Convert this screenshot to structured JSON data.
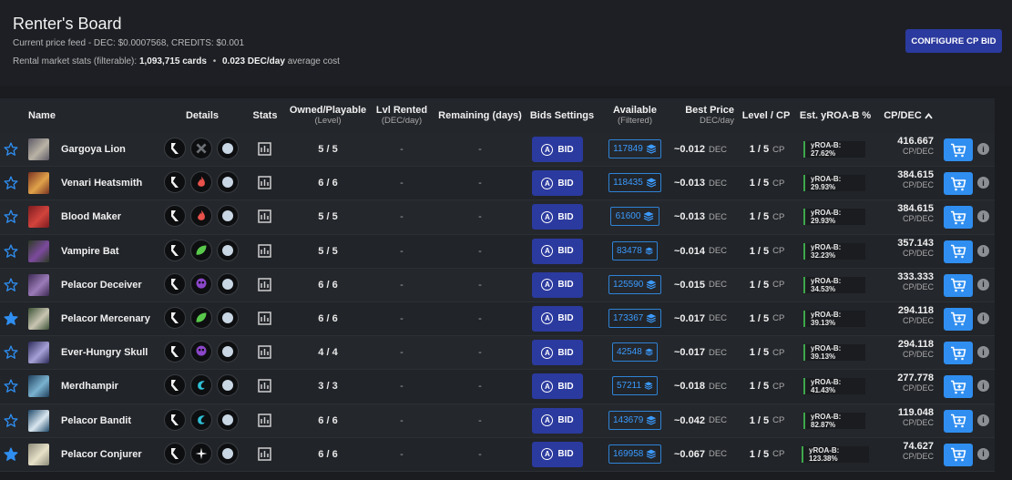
{
  "header": {
    "title": "Renter's Board",
    "price_feed_label": "Current price feed - DEC: $0.0007568, CREDITS: $0.001",
    "stats_prefix": "Rental market stats (filterable):",
    "stats_cards": "1,093,715 cards",
    "stats_sep": "•",
    "stats_cost": "0.023 DEC/day",
    "stats_suffix": "average cost",
    "configure_button": "CONFIGURE CP BID"
  },
  "columns": {
    "name": "Name",
    "details": "Details",
    "stats": "Stats",
    "owned": "Owned/Playable",
    "owned_sub": "(Level)",
    "lvl_rented": "Lvl Rented",
    "lvl_rented_sub": "(DEC/day)",
    "remaining": "Remaining (days)",
    "bids_settings": "Bids Settings",
    "available": "Available",
    "available_sub": "(Filtered)",
    "best_price": "Best Price",
    "best_price_sub": "DEC/day",
    "level_cp": "Level / CP",
    "est_yroa": "Est. yROA-B %",
    "cp_dec": "CP/DEC",
    "sort_icon": "chevron-up-icon"
  },
  "labels": {
    "bid": "BID",
    "dec": "DEC",
    "cp": "CP",
    "cp_dec_unit": "CP/DEC",
    "dash": "-"
  },
  "colors": {
    "accent_blue": "#2b3a9e",
    "cart_blue": "#2f8ef0",
    "link_blue": "#3b9bff",
    "yroa_green": "#3ea84b"
  },
  "rows": [
    {
      "favorite": false,
      "name": "Gargoya Lion",
      "element": "neutral",
      "element_color": "#555a60",
      "owned": "5 / 5",
      "lvl_rented": "-",
      "remaining": "-",
      "available": "117849",
      "best_price": "~0.012",
      "level_cp": "1 / 5",
      "yroa": "yROA-B: 27.62%",
      "cp_dec": "416.667",
      "thumb_colors": [
        "#5e5a66",
        "#b9b3a5"
      ]
    },
    {
      "favorite": false,
      "name": "Venari Heatsmith",
      "element": "fire",
      "element_color": "#e8524b",
      "owned": "6 / 6",
      "lvl_rented": "-",
      "remaining": "-",
      "available": "118435",
      "best_price": "~0.013",
      "level_cp": "1 / 5",
      "yroa": "yROA-B: 29.93%",
      "cp_dec": "384.615",
      "thumb_colors": [
        "#7a3322",
        "#e0a24a"
      ]
    },
    {
      "favorite": false,
      "name": "Blood Maker",
      "element": "fire",
      "element_color": "#e8524b",
      "owned": "5 / 5",
      "lvl_rented": "-",
      "remaining": "-",
      "available": "61600",
      "best_price": "~0.013",
      "level_cp": "1 / 5",
      "yroa": "yROA-B: 29.93%",
      "cp_dec": "384.615",
      "thumb_colors": [
        "#7d1b1e",
        "#d2443d"
      ]
    },
    {
      "favorite": false,
      "name": "Vampire Bat",
      "element": "earth",
      "element_color": "#59c94b",
      "owned": "5 / 5",
      "lvl_rented": "-",
      "remaining": "-",
      "available": "83478",
      "best_price": "~0.014",
      "level_cp": "1 / 5",
      "yroa": "yROA-B: 32.23%",
      "cp_dec": "357.143",
      "thumb_colors": [
        "#2b3b23",
        "#7d4a9e"
      ]
    },
    {
      "favorite": false,
      "name": "Pelacor Deceiver",
      "element": "death",
      "element_color": "#8b46c9",
      "owned": "6 / 6",
      "lvl_rented": "-",
      "remaining": "-",
      "available": "125590",
      "best_price": "~0.015",
      "level_cp": "1 / 5",
      "yroa": "yROA-B: 34.53%",
      "cp_dec": "333.333",
      "thumb_colors": [
        "#3c2a52",
        "#9b7bb8"
      ]
    },
    {
      "favorite": true,
      "name": "Pelacor Mercenary",
      "element": "earth",
      "element_color": "#59c94b",
      "owned": "6 / 6",
      "lvl_rented": "-",
      "remaining": "-",
      "available": "173367",
      "best_price": "~0.017",
      "level_cp": "1 / 5",
      "yroa": "yROA-B: 39.13%",
      "cp_dec": "294.118",
      "thumb_colors": [
        "#3b5234",
        "#c9c5b2"
      ]
    },
    {
      "favorite": false,
      "name": "Ever-Hungry Skull",
      "element": "death",
      "element_color": "#8b46c9",
      "owned": "4 / 4",
      "lvl_rented": "-",
      "remaining": "-",
      "available": "42548",
      "best_price": "~0.017",
      "level_cp": "1 / 5",
      "yroa": "yROA-B: 39.13%",
      "cp_dec": "294.118",
      "thumb_colors": [
        "#2c2a5a",
        "#a6a1d6"
      ]
    },
    {
      "favorite": false,
      "name": "Merdhampir",
      "element": "water",
      "element_color": "#2fc0d6",
      "owned": "3 / 3",
      "lvl_rented": "-",
      "remaining": "-",
      "available": "57211",
      "best_price": "~0.018",
      "level_cp": "1 / 5",
      "yroa": "yROA-B: 41.43%",
      "cp_dec": "277.778",
      "thumb_colors": [
        "#1f3f5c",
        "#7ab2cf"
      ]
    },
    {
      "favorite": false,
      "name": "Pelacor Bandit",
      "element": "water",
      "element_color": "#2fc0d6",
      "owned": "6 / 6",
      "lvl_rented": "-",
      "remaining": "-",
      "available": "143679",
      "best_price": "~0.042",
      "level_cp": "1 / 5",
      "yroa": "yROA-B: 82.87%",
      "cp_dec": "119.048",
      "thumb_colors": [
        "#1f4a6b",
        "#d9e6ef"
      ]
    },
    {
      "favorite": true,
      "name": "Pelacor Conjurer",
      "element": "life",
      "element_color": "#f2f2f2",
      "owned": "6 / 6",
      "lvl_rented": "-",
      "remaining": "-",
      "available": "169958",
      "best_price": "~0.067",
      "level_cp": "1 / 5",
      "yroa": "yROA-B: 123.38%",
      "cp_dec": "74.627",
      "thumb_colors": [
        "#8c8a78",
        "#e7e1c8"
      ]
    }
  ]
}
